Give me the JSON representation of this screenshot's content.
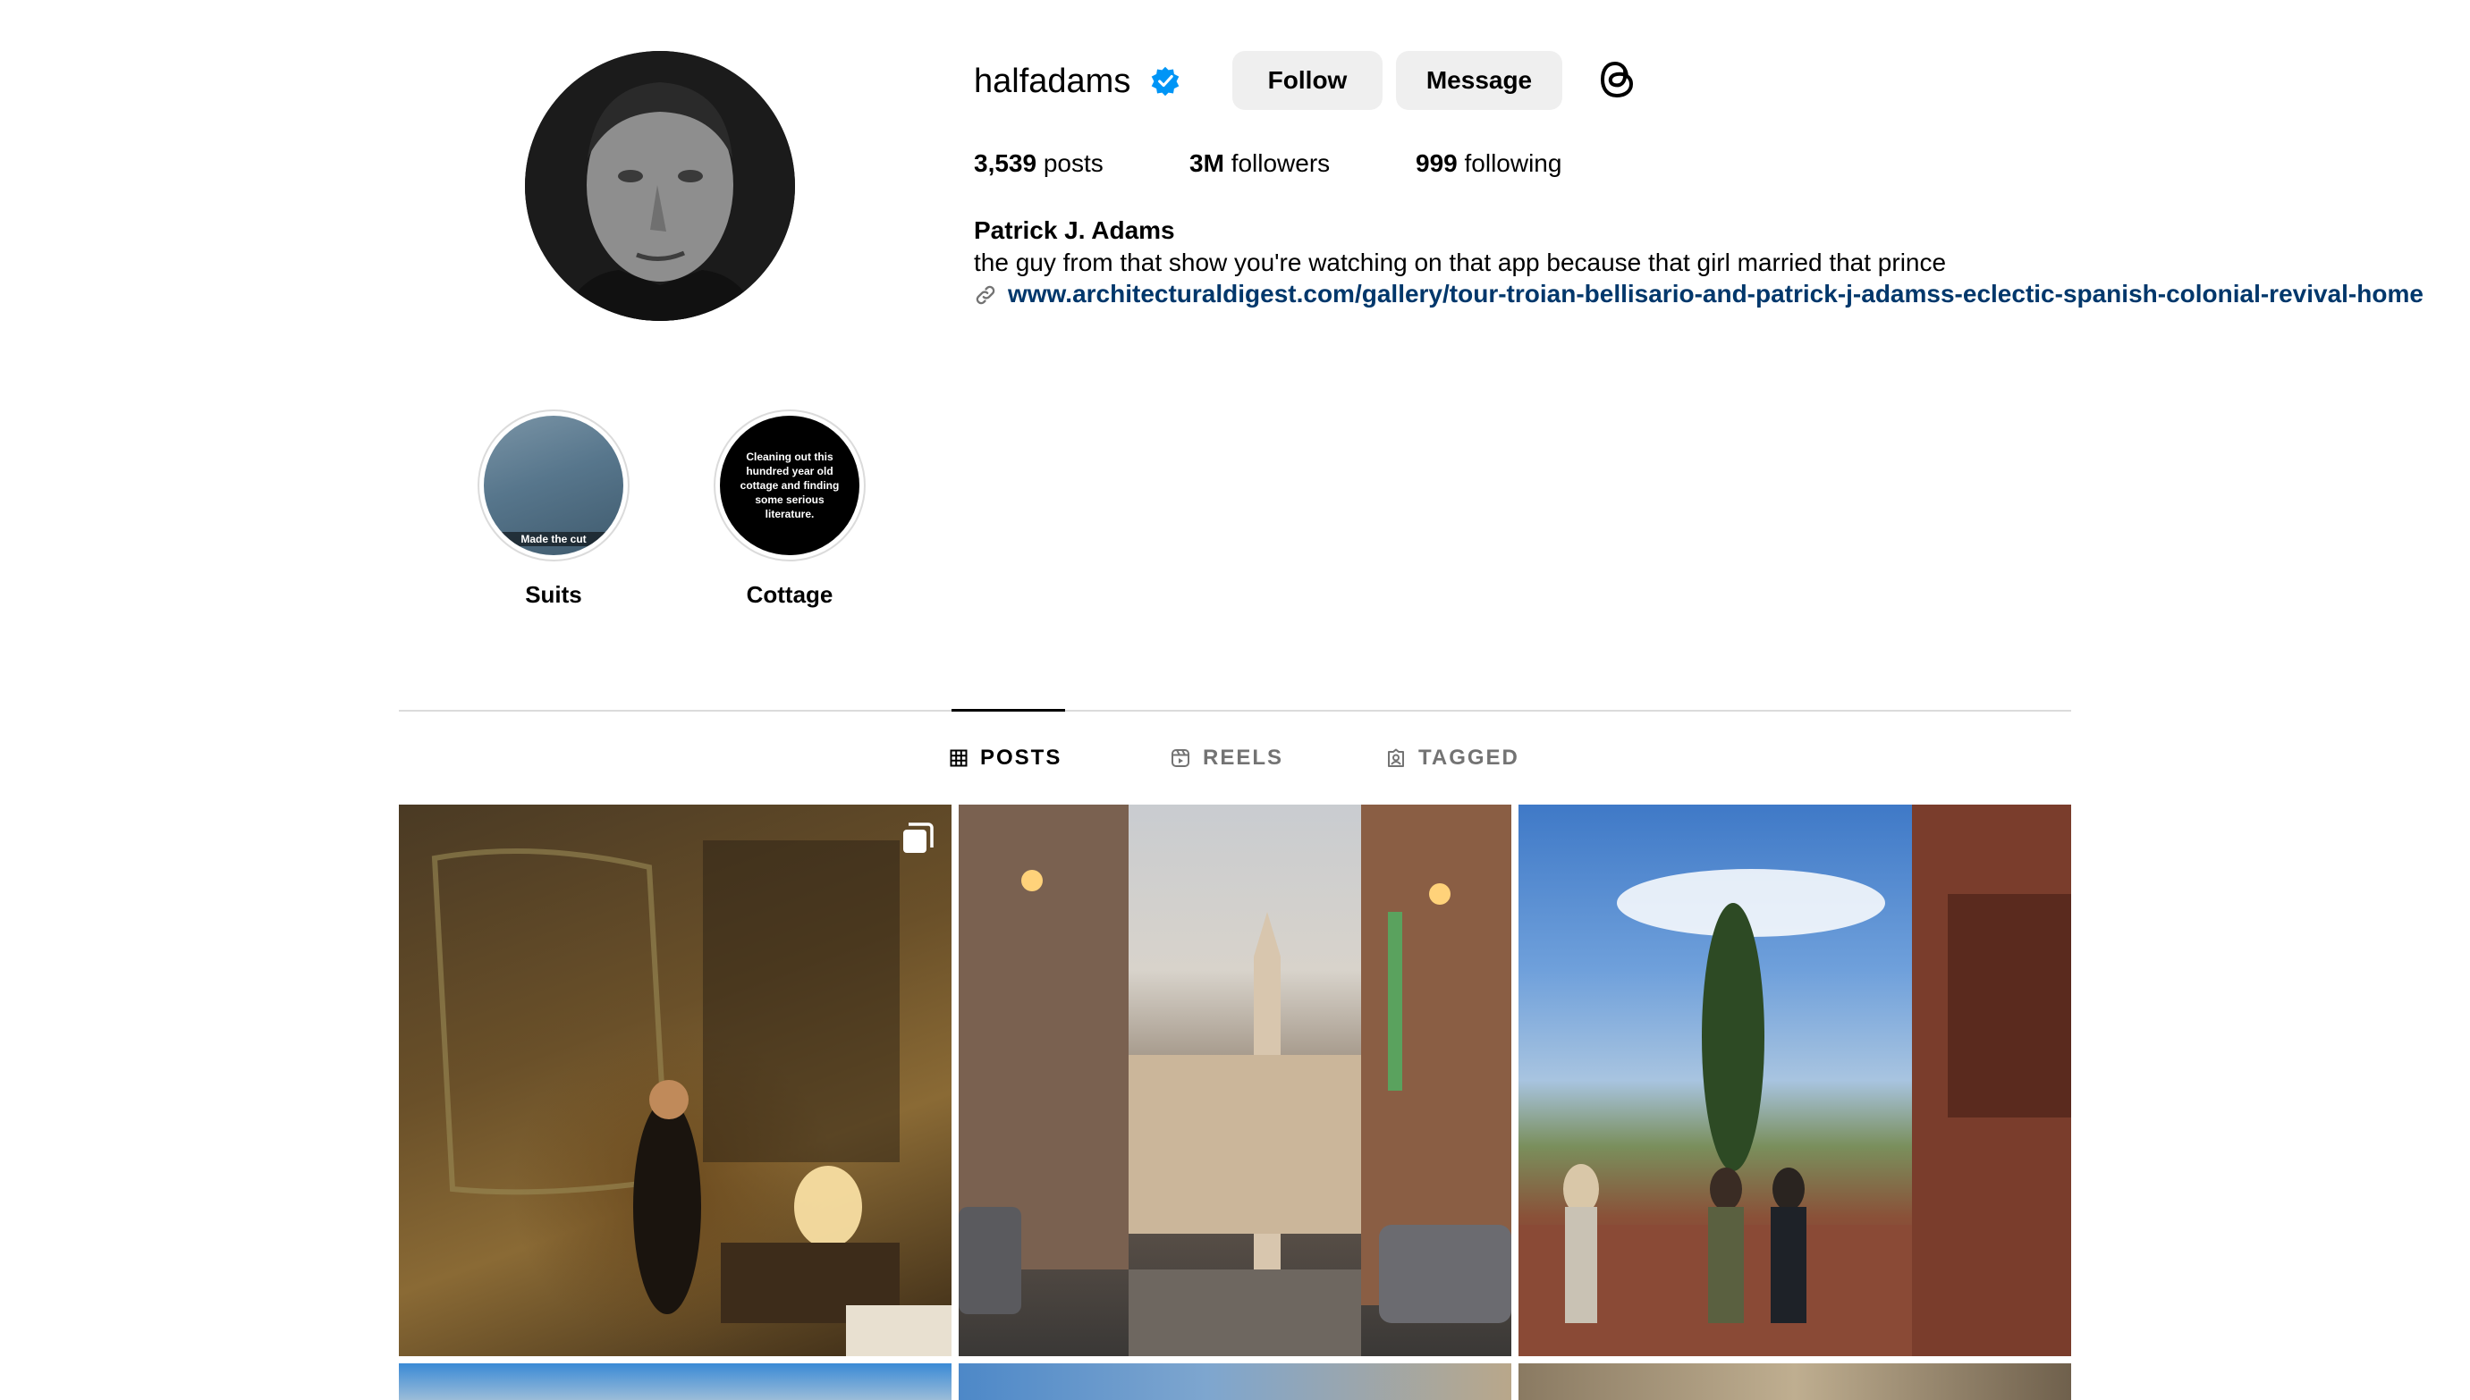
{
  "profile": {
    "username": "halfadams",
    "verified": true,
    "follow_label": "Follow",
    "message_label": "Message",
    "posts_count": "3,539",
    "posts_label": "posts",
    "followers_count": "3M",
    "followers_label": "followers",
    "following_count": "999",
    "following_label": "following",
    "full_name": "Patrick J. Adams",
    "bio": "the guy from that show you're watching on that app because that girl married that prince",
    "link": "www.architecturaldigest.com/gallery/tour-troian-bellisario-and-patrick-j-adamss-eclectic-spanish-colonial-revival-home"
  },
  "highlights": [
    {
      "label": "Suits",
      "cover_caption": "Made the cut"
    },
    {
      "label": "Cottage",
      "cover_caption": "Cleaning out this hundred year old cottage and finding some serious literature."
    }
  ],
  "tabs": [
    {
      "label": "POSTS",
      "active": true
    },
    {
      "label": "REELS",
      "active": false
    },
    {
      "label": "TAGGED",
      "active": false
    }
  ],
  "colors": {
    "verified_blue": "#0095f6",
    "link_blue": "#00376b",
    "button_gray": "#efefef",
    "inactive_tab": "#737373"
  }
}
